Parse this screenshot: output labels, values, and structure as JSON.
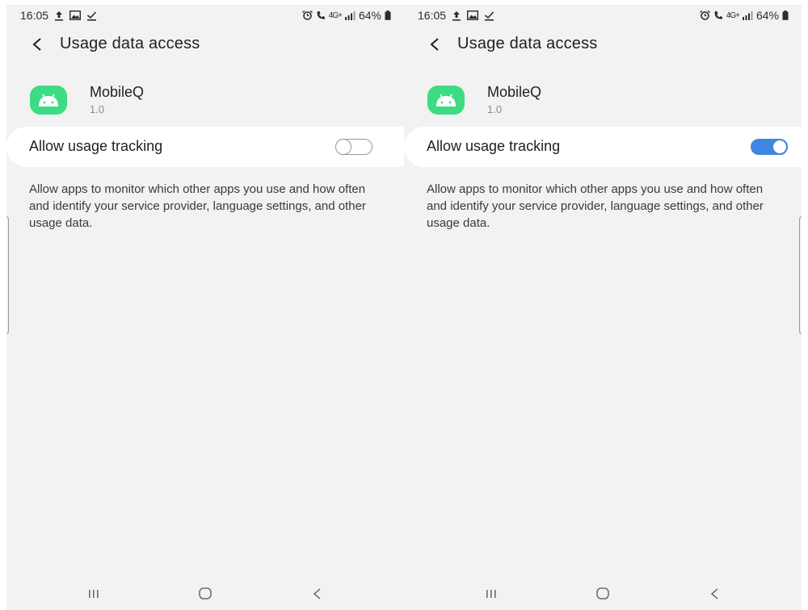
{
  "screens": [
    {
      "status": {
        "time": "16:05",
        "network": "4G+",
        "battery": "64%",
        "left_icons": [
          "upload-icon",
          "gallery-icon",
          "download-done-icon"
        ],
        "right_icons": [
          "alarm-icon",
          "call-icon",
          "network-4g-icon",
          "signal-icon",
          "battery-icon"
        ]
      },
      "header": {
        "title": "Usage data access"
      },
      "app": {
        "name": "MobileQ",
        "version": "1.0",
        "icon": "android-app-icon",
        "icon_color": "#3ddc84"
      },
      "toggle": {
        "label": "Allow usage tracking",
        "state": "off"
      },
      "description": "Allow apps to monitor which other apps you use and how often and identify your service provider, language settings, and other usage data.",
      "nav": [
        "recent-apps-icon",
        "home-icon",
        "back-icon"
      ]
    },
    {
      "status": {
        "time": "16:05",
        "network": "4G+",
        "battery": "64%",
        "left_icons": [
          "upload-icon",
          "gallery-icon",
          "download-done-icon"
        ],
        "right_icons": [
          "alarm-icon",
          "call-icon",
          "network-4g-icon",
          "signal-icon",
          "battery-icon"
        ]
      },
      "header": {
        "title": "Usage data access"
      },
      "app": {
        "name": "MobileQ",
        "version": "1.0",
        "icon": "android-app-icon",
        "icon_color": "#3ddc84"
      },
      "toggle": {
        "label": "Allow usage tracking",
        "state": "on",
        "accent_color": "#3e86e0"
      },
      "description": "Allow apps to monitor which other apps you use and how often and identify your service provider, language settings, and other usage data.",
      "nav": [
        "recent-apps-icon",
        "home-icon",
        "back-icon"
      ]
    }
  ]
}
